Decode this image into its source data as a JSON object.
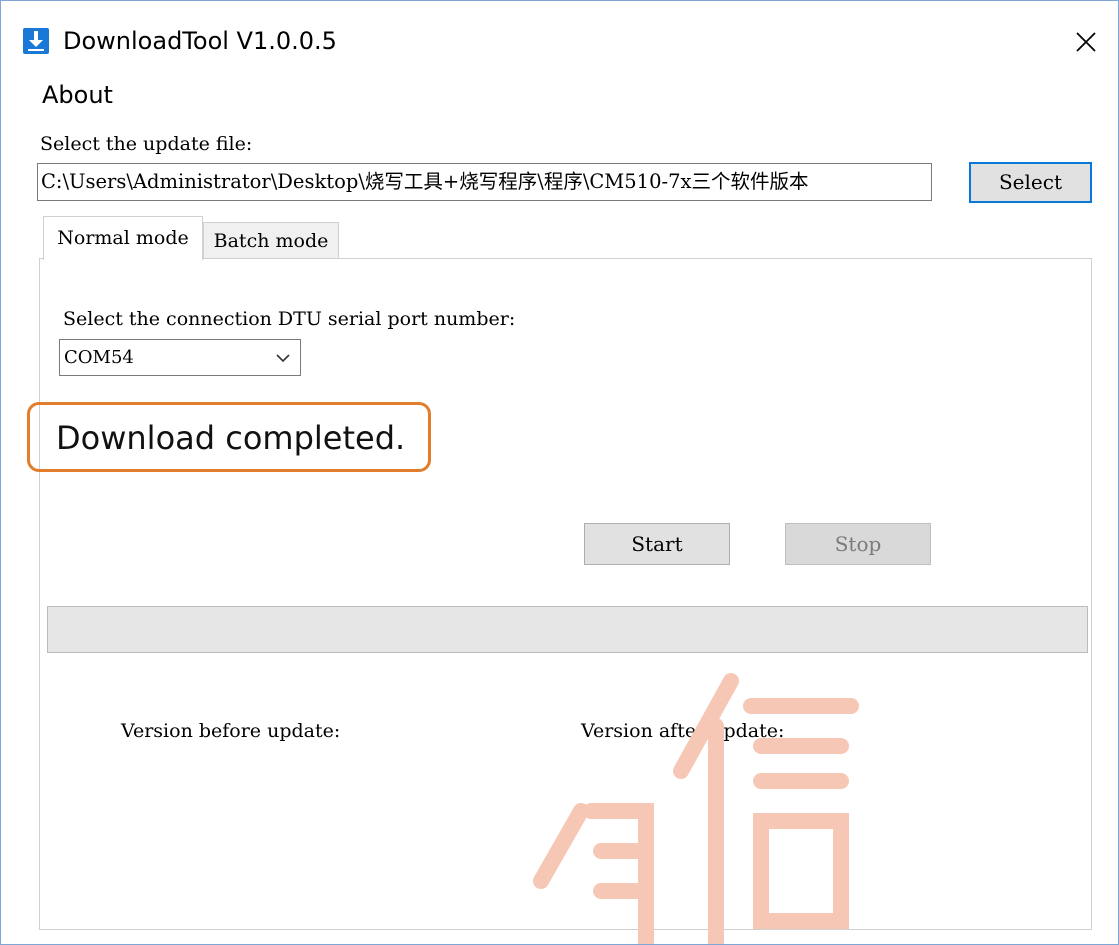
{
  "window": {
    "title": "DownloadTool V1.0.0.5",
    "close_glyph": "✕"
  },
  "menu": {
    "about": "About"
  },
  "file": {
    "label": "Select the update file:",
    "path": "C:\\Users\\Administrator\\Desktop\\烧写工具+烧写程序\\程序\\CM510-7x三个软件版本",
    "select_button": "Select"
  },
  "tabs": [
    {
      "label": "Normal mode",
      "active": true
    },
    {
      "label": "Batch mode",
      "active": false
    }
  ],
  "normal_mode": {
    "port_label": "Select the connection DTU serial port number:",
    "port_value": "COM54",
    "status": "Download completed.",
    "start_button": "Start",
    "stop_button": "Stop",
    "stop_enabled": false,
    "progress": 0,
    "version_before_label": "Version before update:",
    "version_after_label": "Version after update:"
  },
  "colors": {
    "accent": "#0a78d7",
    "highlight": "#e17d2b",
    "watermark": "#f6c7b5"
  },
  "icons": {
    "app": "download-icon",
    "close": "close-icon",
    "dropdown": "chevron-down-icon"
  }
}
